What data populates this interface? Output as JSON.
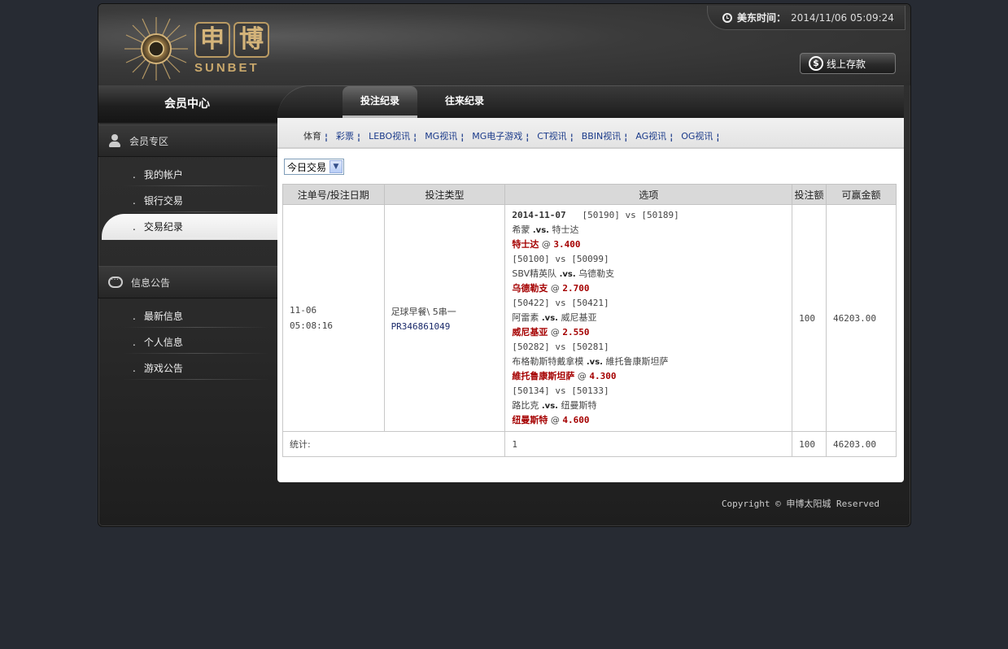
{
  "header": {
    "logo_cn1": "申",
    "logo_cn2": "博",
    "logo_en": "SUNBET",
    "time_label": "美东时间：",
    "time_value": "2014/11/06 05:09:24",
    "deposit_label": "线上存款"
  },
  "sidebar": {
    "title": "会员中心",
    "sections": [
      {
        "title": "会员专区",
        "items": [
          "我的帐户",
          "银行交易",
          "交易纪录"
        ]
      },
      {
        "title": "信息公告",
        "items": [
          "最新信息",
          "个人信息",
          "游戏公告"
        ]
      }
    ],
    "active_item": "交易纪录"
  },
  "tabs": [
    "投注纪录",
    "往来纪录"
  ],
  "active_tab": "投注纪录",
  "game_nav": [
    "体育",
    "彩票",
    "LEBO视讯",
    "MG视讯",
    "MG电子游戏",
    "CT视讯",
    "BBIN视讯",
    "AG视讯",
    "OG视讯"
  ],
  "filter": {
    "selected": "今日交易"
  },
  "table": {
    "headers": [
      "注单号/投注日期",
      "投注类型",
      "选项",
      "投注额",
      "可赢金额"
    ],
    "row": {
      "date": "11-06",
      "time": "05:08:16",
      "bet_type": "足球早餐\\ 5串一",
      "order_no": "PR346861049",
      "selection_date": "2014-11-07",
      "legs": [
        {
          "ids": "[50190] vs [50189]",
          "home": "希蒙",
          "away": "特士达",
          "pick": "特士达",
          "odds": "3.400"
        },
        {
          "ids": "[50100] vs [50099]",
          "home": "SBV精英队",
          "away": "乌德勒支",
          "pick": "乌德勒支",
          "odds": "2.700"
        },
        {
          "ids": "[50422] vs [50421]",
          "home": "阿雷素",
          "away": "威尼基亚",
          "pick": "威尼基亚",
          "odds": "2.550"
        },
        {
          "ids": "[50282] vs [50281]",
          "home": "布格勒斯特戴拿模",
          "away": "維托鲁康斯坦萨",
          "pick": "維托鲁康斯坦萨",
          "odds": "4.300"
        },
        {
          "ids": "[50134] vs [50133]",
          "home": "路比克",
          "away": "纽曼斯特",
          "pick": "纽曼斯特",
          "odds": "4.600"
        }
      ],
      "vs_text": ".vs.",
      "at_text": "@",
      "amount": "100",
      "win": "46203.00"
    },
    "summary": {
      "label": "统计:",
      "count": "1",
      "amount": "100",
      "win": "46203.00"
    }
  },
  "footer": {
    "copyright": "Copyright © 申博太阳城 Reserved"
  },
  "colors": {
    "background": "#272b33",
    "pick_red": "#a50000",
    "link_blue": "#1a3a8a",
    "gold": "#c9a86c"
  }
}
